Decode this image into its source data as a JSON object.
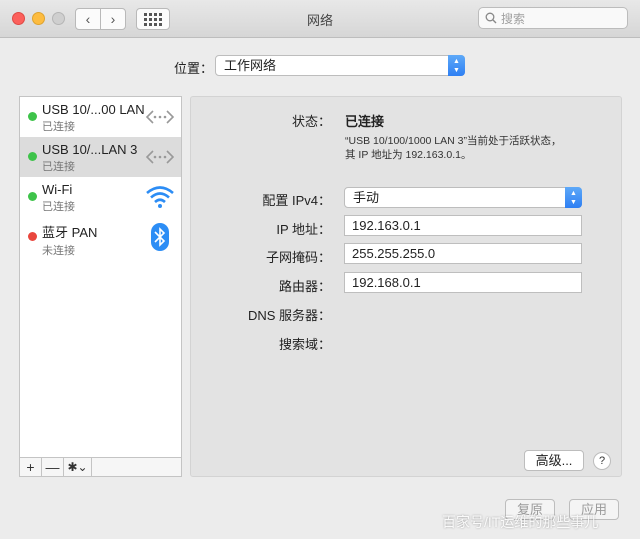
{
  "window": {
    "title": "网络"
  },
  "search": {
    "placeholder": "搜索"
  },
  "location": {
    "label": "位置：",
    "value": "工作网络"
  },
  "services": [
    {
      "name": "USB 10/...00 LAN",
      "status": "已连接",
      "status_color": "#3ec34a",
      "icon": "ethernet-icon"
    },
    {
      "name": "USB 10/...LAN 3",
      "status": "已连接",
      "status_color": "#3ec34a",
      "icon": "ethernet-icon"
    },
    {
      "name": "Wi-Fi",
      "status": "已连接",
      "status_color": "#3ec34a",
      "icon": "wifi-icon"
    },
    {
      "name": "蓝牙 PAN",
      "status": "未连接",
      "status_color": "#e9463d",
      "icon": "bluetooth-icon"
    }
  ],
  "sidebar_buttons": {
    "add": "+",
    "remove": "—",
    "gear": "✱⌄"
  },
  "detail": {
    "status_label": "状态：",
    "status_value": "已连接",
    "status_desc_line1": "“USB 10/100/1000 LAN 3”当前处于活跃状态，",
    "status_desc_line2": "其 IP 地址为 192.163.0.1。",
    "configure_label": "配置 IPv4：",
    "configure_value": "手动",
    "ip_label": "IP 地址：",
    "ip_value": "192.163.0.1",
    "subnet_label": "子网掩码：",
    "subnet_value": "255.255.255.0",
    "router_label": "路由器：",
    "router_value": "192.168.0.1",
    "dns_label": "DNS 服务器：",
    "search_domain_label": "搜索域：",
    "advanced_button": "高级...",
    "help_button": "?"
  },
  "footer": {
    "revert_button": "复原",
    "apply_button": "应用"
  },
  "watermark": "百家号/IT运维的那些事儿"
}
